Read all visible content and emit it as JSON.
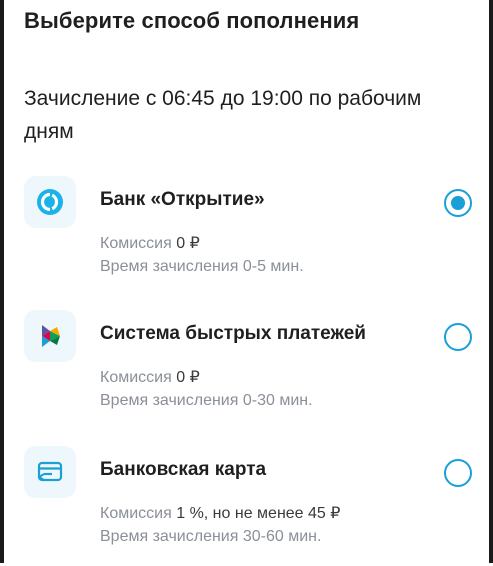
{
  "title": "Выберите способ пополнения",
  "subtitle": "Зачисление с 06:45 до 19:00 по рабочим дням",
  "options": [
    {
      "name": "Банк «Открытие»",
      "icon": "otkritie-logo-icon",
      "commission_label": "Комиссия",
      "commission_value": "0 ₽",
      "time": "Время зачисления 0-5 мин.",
      "selected": true
    },
    {
      "name": "Система быстрых платежей",
      "icon": "sbp-logo-icon",
      "commission_label": "Комиссия",
      "commission_value": "0 ₽",
      "time": "Время зачисления 0-30 мин.",
      "selected": false
    },
    {
      "name": "Банковская карта",
      "icon": "bank-card-icon",
      "commission_label": "Комиссия",
      "commission_value": "1 %, но не менее 45 ₽",
      "time": "Время зачисления 30-60 мин.",
      "selected": false
    }
  ],
  "colors": {
    "accent": "#1a9fd6",
    "muted_text": "#8a8f98",
    "icon_bg": "#eef7fb"
  }
}
